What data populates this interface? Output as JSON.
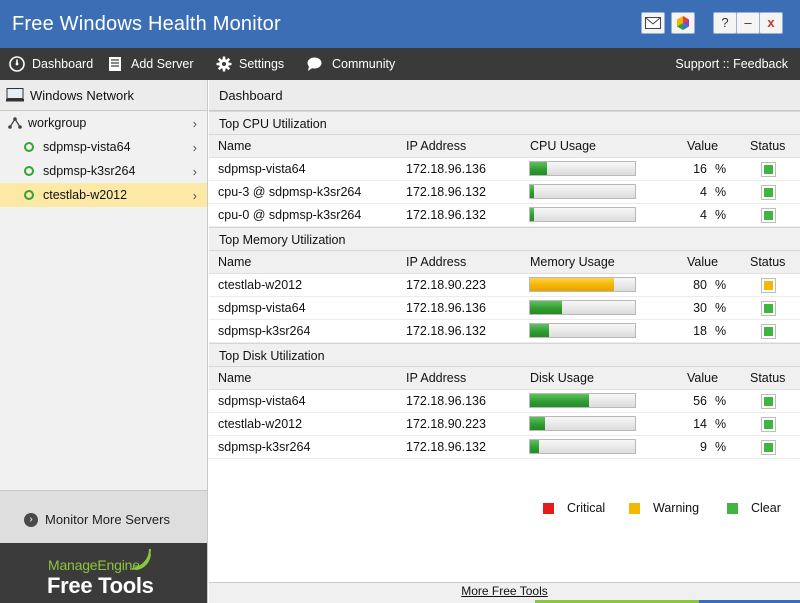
{
  "window": {
    "title": "Free Windows Health Monitor"
  },
  "menu": {
    "items": [
      {
        "label": "Dashboard",
        "icon": "dashboard-icon"
      },
      {
        "label": "Add Server",
        "icon": "server-icon"
      },
      {
        "label": "Settings",
        "icon": "gear-icon"
      },
      {
        "label": "Community",
        "icon": "chat-bubble-icon"
      }
    ],
    "support": "Support :: Feedback"
  },
  "sidebar": {
    "header": "Windows Network",
    "group": "workgroup",
    "servers": [
      {
        "name": "sdpmsp-vista64",
        "selected": false
      },
      {
        "name": "sdpmsp-k3sr264",
        "selected": false
      },
      {
        "name": "ctestlab-w2012",
        "selected": true
      }
    ],
    "monitor_more": "Monitor More Servers",
    "brand_top": "ManageEngine",
    "brand_bottom": "Free Tools"
  },
  "main": {
    "header": "Dashboard",
    "columns": {
      "name": "Name",
      "ip": "IP Address",
      "value": "Value",
      "status": "Status"
    },
    "sections": [
      {
        "title": "Top CPU Utilization",
        "usage_label": "CPU Usage",
        "rows": [
          {
            "name": "sdpmsp-vista64",
            "ip": "172.18.96.136",
            "value": "16",
            "pct": 0.16,
            "level": "green"
          },
          {
            "name": "cpu-3 @ sdpmsp-k3sr264",
            "ip": "172.18.96.132",
            "value": "4",
            "pct": 0.04,
            "level": "green"
          },
          {
            "name": "cpu-0 @ sdpmsp-k3sr264",
            "ip": "172.18.96.132",
            "value": "4",
            "pct": 0.04,
            "level": "green"
          }
        ]
      },
      {
        "title": "Top Memory Utilization",
        "usage_label": "Memory Usage",
        "rows": [
          {
            "name": "ctestlab-w2012",
            "ip": "172.18.90.223",
            "value": "80",
            "pct": 0.8,
            "level": "yellow"
          },
          {
            "name": "sdpmsp-vista64",
            "ip": "172.18.96.136",
            "value": "30",
            "pct": 0.3,
            "level": "green"
          },
          {
            "name": "sdpmsp-k3sr264",
            "ip": "172.18.96.132",
            "value": "18",
            "pct": 0.18,
            "level": "green"
          }
        ]
      },
      {
        "title": "Top Disk Utilization",
        "usage_label": "Disk Usage",
        "rows": [
          {
            "name": "sdpmsp-vista64",
            "ip": "172.18.96.136",
            "value": "56",
            "pct": 0.56,
            "level": "green"
          },
          {
            "name": "ctestlab-w2012",
            "ip": "172.18.90.223",
            "value": "14",
            "pct": 0.14,
            "level": "green"
          },
          {
            "name": "sdpmsp-k3sr264",
            "ip": "172.18.96.132",
            "value": "9",
            "pct": 0.09,
            "level": "green"
          }
        ]
      }
    ],
    "percent_sign": "%",
    "legend": [
      {
        "label": "Critical",
        "color": "#e31b1b"
      },
      {
        "label": "Warning",
        "color": "#f5b800"
      },
      {
        "label": "Clear",
        "color": "#3fb53f"
      }
    ],
    "footer_link": "More Free Tools"
  }
}
